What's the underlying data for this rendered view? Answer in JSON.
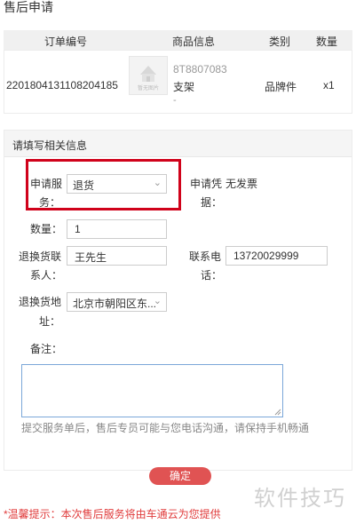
{
  "page": {
    "title": "售后申请"
  },
  "order_table": {
    "headers": [
      "订单编号",
      "商品信息",
      "类别",
      "数量"
    ],
    "row": {
      "order_no": "2201804131108204185",
      "thumb_watermark": "暂无图片",
      "goods_code": "8T8807083",
      "goods_name": "支架",
      "goods_extra": "-",
      "category": "品牌件",
      "quantity": "x1"
    }
  },
  "form": {
    "section_title": "请填写相关信息",
    "service_label_1": "申请服",
    "service_label_2": "务：",
    "service_value": "退货",
    "voucher_label_1": "申请凭",
    "voucher_label_2": "据：",
    "voucher_value": "无发票",
    "qty_label": "数量：",
    "qty_value": "1",
    "contact_label_1": "退换货联",
    "contact_label_2": "系人：",
    "contact_value": "王先生",
    "phone_label_1": "联系电",
    "phone_label_2": "话：",
    "phone_value": "13720029999",
    "address_label_1": "退换货地",
    "address_label_2": "址：",
    "address_value": "北京市朝阳区东...",
    "note_label": "备注：",
    "note_value": "",
    "hint": "提交服务单后，售后专员可能与您电话沟通，请保持手机畅通"
  },
  "confirm_label": "确定",
  "tip": "*温馨提示：本次售后服务将由车通云为您提供",
  "watermark": "软件技巧",
  "colors": {
    "highlight": "#d0021b",
    "confirm_button": "#e05353",
    "tip": "#e03c3c"
  }
}
